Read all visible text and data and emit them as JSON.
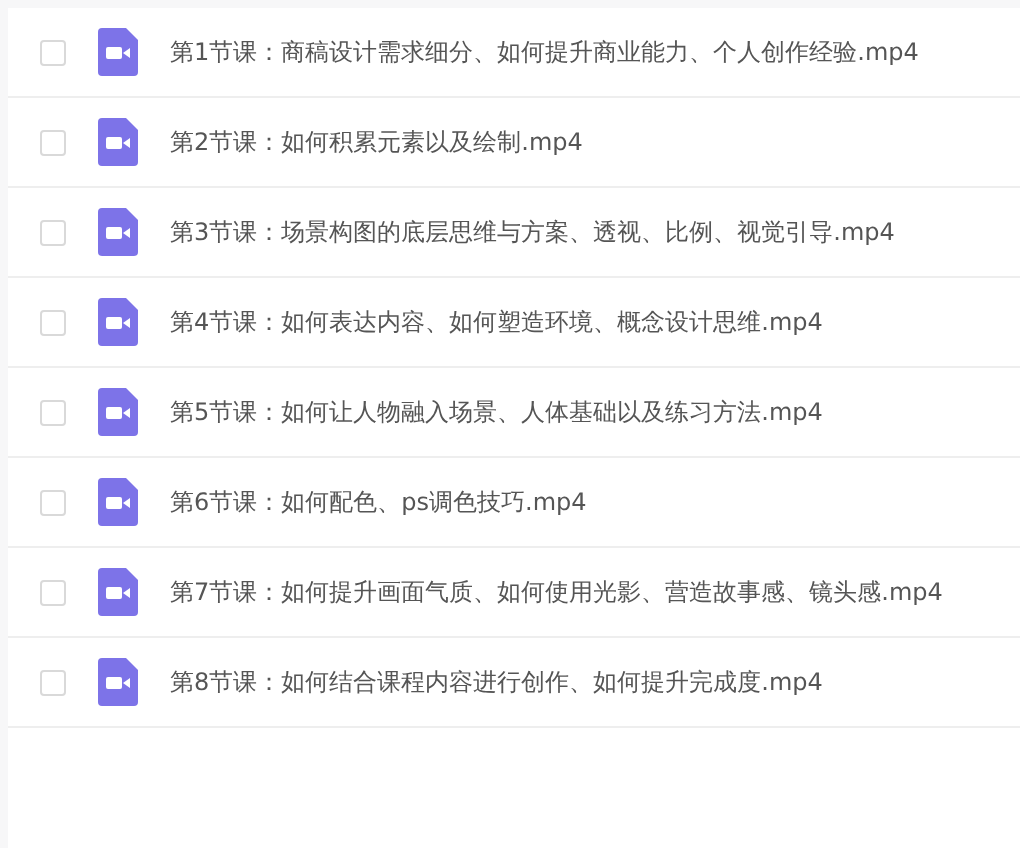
{
  "files": [
    {
      "name": "第1节课：商稿设计需求细分、如何提升商业能力、个人创作经验.mp4",
      "checked": false
    },
    {
      "name": "第2节课：如何积累元素以及绘制.mp4",
      "checked": false
    },
    {
      "name": "第3节课：场景构图的底层思维与方案、透视、比例、视觉引导.mp4",
      "checked": false
    },
    {
      "name": "第4节课：如何表达内容、如何塑造环境、概念设计思维.mp4",
      "checked": false
    },
    {
      "name": "第5节课：如何让人物融入场景、人体基础以及练习方法.mp4",
      "checked": false
    },
    {
      "name": "第6节课：如何配色、ps调色技巧.mp4",
      "checked": false
    },
    {
      "name": "第7节课：如何提升画面气质、如何使用光影、营造故事感、镜头感.mp4",
      "checked": false
    },
    {
      "name": "第8节课：如何结合课程内容进行创作、如何提升完成度.mp4",
      "checked": false
    }
  ]
}
